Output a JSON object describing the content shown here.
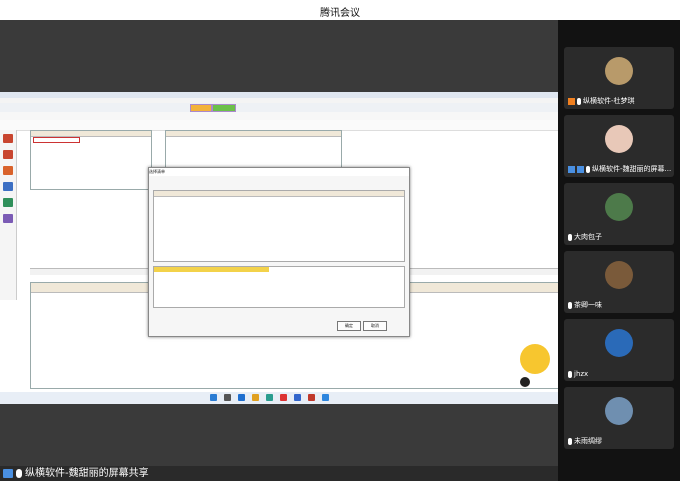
{
  "window": {
    "title": "腾讯会议"
  },
  "share": {
    "label": "纵横软件-魏甜丽的屏幕共享"
  },
  "participants": [
    {
      "name": "纵横软件-杜梦琪"
    },
    {
      "name": "纵横软件-魏甜丽的屏幕..."
    },
    {
      "name": "大肉包子"
    },
    {
      "name": "茶卿一味"
    },
    {
      "name": "jhzx"
    },
    {
      "name": "未雨绸缪"
    }
  ],
  "dialog": {
    "title": "选择清单",
    "ok_label": "确定",
    "cancel_label": "取消"
  },
  "colors": {
    "accent": "#4a90e2",
    "host_badge": "#f08020"
  }
}
